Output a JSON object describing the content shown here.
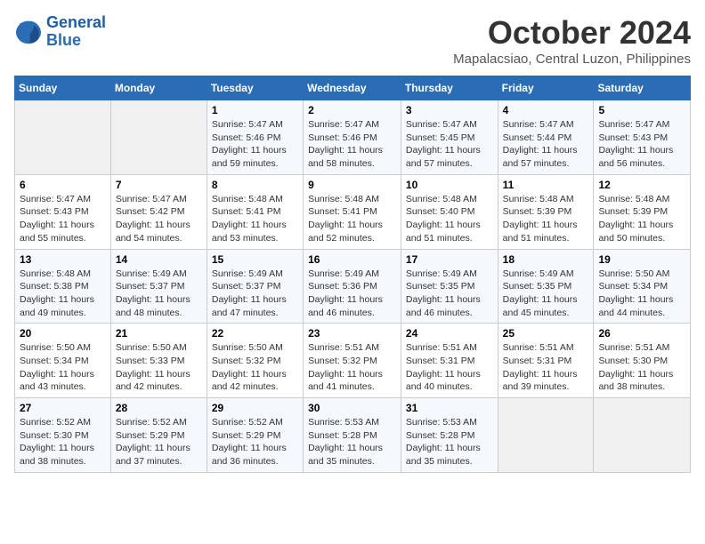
{
  "header": {
    "logo_line1": "General",
    "logo_line2": "Blue",
    "month": "October 2024",
    "location": "Mapalacsiao, Central Luzon, Philippines"
  },
  "days_of_week": [
    "Sunday",
    "Monday",
    "Tuesday",
    "Wednesday",
    "Thursday",
    "Friday",
    "Saturday"
  ],
  "weeks": [
    [
      {
        "day": "",
        "sunrise": "",
        "sunset": "",
        "daylight": ""
      },
      {
        "day": "",
        "sunrise": "",
        "sunset": "",
        "daylight": ""
      },
      {
        "day": "1",
        "sunrise": "Sunrise: 5:47 AM",
        "sunset": "Sunset: 5:46 PM",
        "daylight": "Daylight: 11 hours and 59 minutes."
      },
      {
        "day": "2",
        "sunrise": "Sunrise: 5:47 AM",
        "sunset": "Sunset: 5:46 PM",
        "daylight": "Daylight: 11 hours and 58 minutes."
      },
      {
        "day": "3",
        "sunrise": "Sunrise: 5:47 AM",
        "sunset": "Sunset: 5:45 PM",
        "daylight": "Daylight: 11 hours and 57 minutes."
      },
      {
        "day": "4",
        "sunrise": "Sunrise: 5:47 AM",
        "sunset": "Sunset: 5:44 PM",
        "daylight": "Daylight: 11 hours and 57 minutes."
      },
      {
        "day": "5",
        "sunrise": "Sunrise: 5:47 AM",
        "sunset": "Sunset: 5:43 PM",
        "daylight": "Daylight: 11 hours and 56 minutes."
      }
    ],
    [
      {
        "day": "6",
        "sunrise": "Sunrise: 5:47 AM",
        "sunset": "Sunset: 5:43 PM",
        "daylight": "Daylight: 11 hours and 55 minutes."
      },
      {
        "day": "7",
        "sunrise": "Sunrise: 5:47 AM",
        "sunset": "Sunset: 5:42 PM",
        "daylight": "Daylight: 11 hours and 54 minutes."
      },
      {
        "day": "8",
        "sunrise": "Sunrise: 5:48 AM",
        "sunset": "Sunset: 5:41 PM",
        "daylight": "Daylight: 11 hours and 53 minutes."
      },
      {
        "day": "9",
        "sunrise": "Sunrise: 5:48 AM",
        "sunset": "Sunset: 5:41 PM",
        "daylight": "Daylight: 11 hours and 52 minutes."
      },
      {
        "day": "10",
        "sunrise": "Sunrise: 5:48 AM",
        "sunset": "Sunset: 5:40 PM",
        "daylight": "Daylight: 11 hours and 51 minutes."
      },
      {
        "day": "11",
        "sunrise": "Sunrise: 5:48 AM",
        "sunset": "Sunset: 5:39 PM",
        "daylight": "Daylight: 11 hours and 51 minutes."
      },
      {
        "day": "12",
        "sunrise": "Sunrise: 5:48 AM",
        "sunset": "Sunset: 5:39 PM",
        "daylight": "Daylight: 11 hours and 50 minutes."
      }
    ],
    [
      {
        "day": "13",
        "sunrise": "Sunrise: 5:48 AM",
        "sunset": "Sunset: 5:38 PM",
        "daylight": "Daylight: 11 hours and 49 minutes."
      },
      {
        "day": "14",
        "sunrise": "Sunrise: 5:49 AM",
        "sunset": "Sunset: 5:37 PM",
        "daylight": "Daylight: 11 hours and 48 minutes."
      },
      {
        "day": "15",
        "sunrise": "Sunrise: 5:49 AM",
        "sunset": "Sunset: 5:37 PM",
        "daylight": "Daylight: 11 hours and 47 minutes."
      },
      {
        "day": "16",
        "sunrise": "Sunrise: 5:49 AM",
        "sunset": "Sunset: 5:36 PM",
        "daylight": "Daylight: 11 hours and 46 minutes."
      },
      {
        "day": "17",
        "sunrise": "Sunrise: 5:49 AM",
        "sunset": "Sunset: 5:35 PM",
        "daylight": "Daylight: 11 hours and 46 minutes."
      },
      {
        "day": "18",
        "sunrise": "Sunrise: 5:49 AM",
        "sunset": "Sunset: 5:35 PM",
        "daylight": "Daylight: 11 hours and 45 minutes."
      },
      {
        "day": "19",
        "sunrise": "Sunrise: 5:50 AM",
        "sunset": "Sunset: 5:34 PM",
        "daylight": "Daylight: 11 hours and 44 minutes."
      }
    ],
    [
      {
        "day": "20",
        "sunrise": "Sunrise: 5:50 AM",
        "sunset": "Sunset: 5:34 PM",
        "daylight": "Daylight: 11 hours and 43 minutes."
      },
      {
        "day": "21",
        "sunrise": "Sunrise: 5:50 AM",
        "sunset": "Sunset: 5:33 PM",
        "daylight": "Daylight: 11 hours and 42 minutes."
      },
      {
        "day": "22",
        "sunrise": "Sunrise: 5:50 AM",
        "sunset": "Sunset: 5:32 PM",
        "daylight": "Daylight: 11 hours and 42 minutes."
      },
      {
        "day": "23",
        "sunrise": "Sunrise: 5:51 AM",
        "sunset": "Sunset: 5:32 PM",
        "daylight": "Daylight: 11 hours and 41 minutes."
      },
      {
        "day": "24",
        "sunrise": "Sunrise: 5:51 AM",
        "sunset": "Sunset: 5:31 PM",
        "daylight": "Daylight: 11 hours and 40 minutes."
      },
      {
        "day": "25",
        "sunrise": "Sunrise: 5:51 AM",
        "sunset": "Sunset: 5:31 PM",
        "daylight": "Daylight: 11 hours and 39 minutes."
      },
      {
        "day": "26",
        "sunrise": "Sunrise: 5:51 AM",
        "sunset": "Sunset: 5:30 PM",
        "daylight": "Daylight: 11 hours and 38 minutes."
      }
    ],
    [
      {
        "day": "27",
        "sunrise": "Sunrise: 5:52 AM",
        "sunset": "Sunset: 5:30 PM",
        "daylight": "Daylight: 11 hours and 38 minutes."
      },
      {
        "day": "28",
        "sunrise": "Sunrise: 5:52 AM",
        "sunset": "Sunset: 5:29 PM",
        "daylight": "Daylight: 11 hours and 37 minutes."
      },
      {
        "day": "29",
        "sunrise": "Sunrise: 5:52 AM",
        "sunset": "Sunset: 5:29 PM",
        "daylight": "Daylight: 11 hours and 36 minutes."
      },
      {
        "day": "30",
        "sunrise": "Sunrise: 5:53 AM",
        "sunset": "Sunset: 5:28 PM",
        "daylight": "Daylight: 11 hours and 35 minutes."
      },
      {
        "day": "31",
        "sunrise": "Sunrise: 5:53 AM",
        "sunset": "Sunset: 5:28 PM",
        "daylight": "Daylight: 11 hours and 35 minutes."
      },
      {
        "day": "",
        "sunrise": "",
        "sunset": "",
        "daylight": ""
      },
      {
        "day": "",
        "sunrise": "",
        "sunset": "",
        "daylight": ""
      }
    ]
  ]
}
